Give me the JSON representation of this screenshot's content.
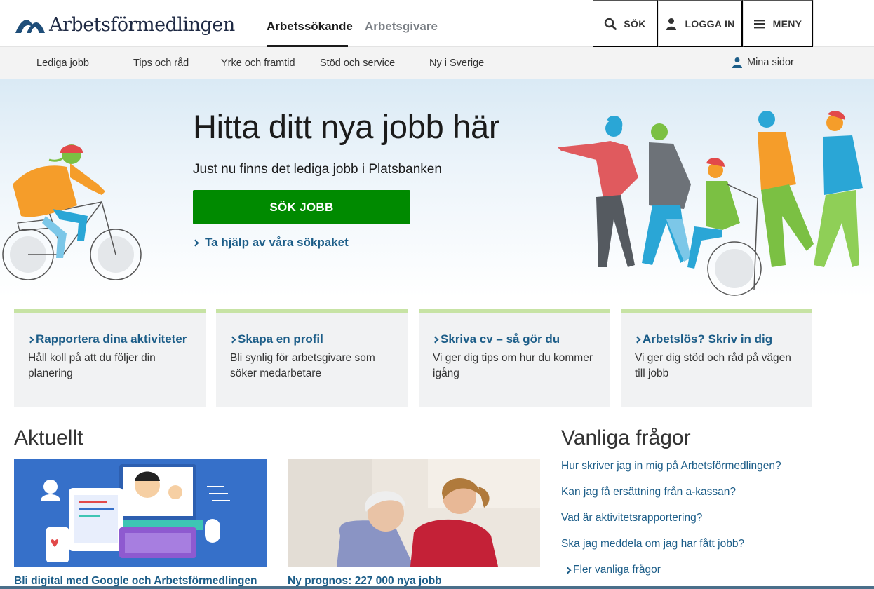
{
  "header": {
    "logo_text": "Arbetsförmedlingen",
    "tabs": [
      {
        "label": "Arbetssökande",
        "active": true
      },
      {
        "label": "Arbetsgivare",
        "active": false
      }
    ],
    "buttons": {
      "search": "SÖK",
      "login": "LOGGA IN",
      "menu": "MENY"
    }
  },
  "subnav": {
    "items": [
      "Lediga jobb",
      "Tips och råd",
      "Yrke och framtid",
      "Stöd och service",
      "Ny i Sverige"
    ],
    "mina_sidor": "Mina sidor"
  },
  "hero": {
    "title": "Hitta ditt nya jobb här",
    "subtitle": "Just nu finns det lediga jobb i Platsbanken",
    "button": "SÖK JOBB",
    "link": "Ta hjälp av våra sökpaket"
  },
  "cards": [
    {
      "title": "Rapportera dina aktiviteter",
      "text": "Håll koll på att du följer din planering"
    },
    {
      "title": "Skapa en profil",
      "text": "Bli synlig för arbetsgivare som söker medarbetare"
    },
    {
      "title": "Skriva cv – så gör du",
      "text": "Vi ger dig tips om hur du kommer igång"
    },
    {
      "title": "Arbetslös? Skriv in dig",
      "text": "Vi ger dig stöd och råd på vägen till jobb"
    }
  ],
  "news": {
    "title": "Aktuellt",
    "items": [
      {
        "caption": "Bli digital med Google och Arbetsförmedlingen"
      },
      {
        "caption": "Ny prognos: 227 000 nya jobb"
      }
    ]
  },
  "faq": {
    "title": "Vanliga frågor",
    "items": [
      "Hur skriver jag in mig på Arbetsförmedlingen?",
      "Kan jag få ersättning från a-kassan?",
      "Vad är aktivitetsrapportering?",
      "Ska jag meddela om jag har fått jobb?"
    ],
    "more": "Fler vanliga frågor"
  },
  "colors": {
    "link": "#1c5d88",
    "primary_button": "#008a00",
    "card_accent": "#c7e3a4",
    "logo": "#1f2a44"
  }
}
